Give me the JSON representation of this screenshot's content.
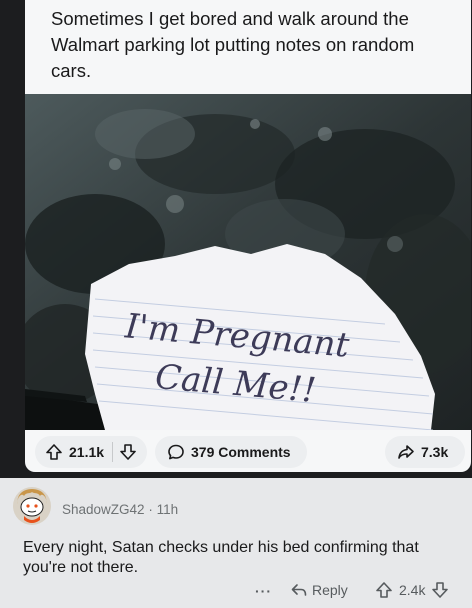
{
  "post": {
    "title": "Sometimes I get bored and walk around the Walmart parking lot putting notes on random cars.",
    "photo": {
      "note_line1": "I'm Pregnant",
      "note_line2": "Call Me!!"
    },
    "upvotes": "21.1k",
    "comments": "379 Comments",
    "shares": "7.3k",
    "icons": [
      "upvote-icon",
      "downvote-icon",
      "comment-icon",
      "share-icon"
    ]
  },
  "comment": {
    "author": "ShadowZG42",
    "separator": "·",
    "age": "11h",
    "body": "Every night, Satan checks under his bed confirming that you're not there.",
    "more": "···",
    "reply_label": "Reply",
    "score": "2.4k"
  },
  "colors": {
    "background": "#1c1d1f",
    "card": "#f6f7f8",
    "pill": "#eceef0",
    "comment_bg": "#e7e8ea",
    "note_ink": "#3d3b58"
  }
}
